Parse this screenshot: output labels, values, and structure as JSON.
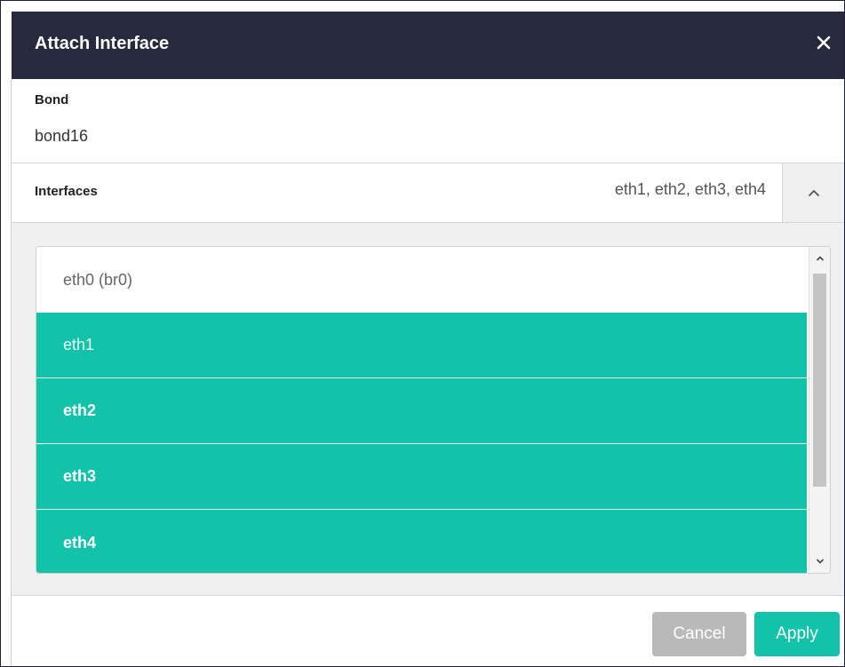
{
  "dialog": {
    "title": "Attach Interface",
    "close_icon": "close-icon"
  },
  "bond": {
    "label": "Bond",
    "value": "bond16"
  },
  "interfaces": {
    "label": "Interfaces",
    "selected_summary": "eth1, eth2, eth3, eth4",
    "toggle_icon": "chevron-up-icon",
    "options": [
      {
        "label": "eth0 (br0)",
        "selected": false
      },
      {
        "label": "eth1",
        "selected": true
      },
      {
        "label": "eth2",
        "selected": true
      },
      {
        "label": "eth3",
        "selected": true
      },
      {
        "label": "eth4",
        "selected": true
      }
    ]
  },
  "footer": {
    "cancel_label": "Cancel",
    "apply_label": "Apply"
  },
  "colors": {
    "title_bar": "#262a3c",
    "accent": "#12c2a9",
    "cancel": "#b9b9b9"
  }
}
